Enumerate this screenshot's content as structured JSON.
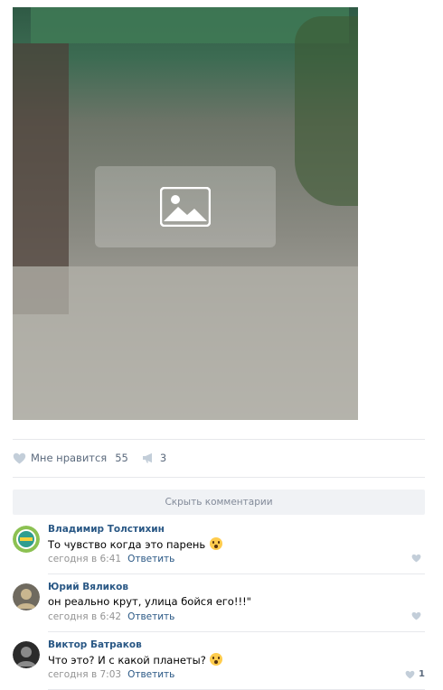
{
  "post": {
    "photo_alt": "Фото записи",
    "like_label": "Мне нравится",
    "like_count": "55",
    "share_count": "3"
  },
  "hide_comments_label": "Скрыть комментарии",
  "comments": [
    {
      "author": "Владимир Толстихин",
      "text": "То чувство когда это парень",
      "time": "сегодня в 6:41",
      "reply_label": "Ответить",
      "likes": ""
    },
    {
      "author": "Юрий Вяликов",
      "text": "он реально крут, улица бойся его!!!\"",
      "time": "сегодня в 6:42",
      "reply_label": "Ответить",
      "likes": ""
    },
    {
      "author": "Виктор Батраков",
      "text": "Что это? И с какой планеты?",
      "time": "сегодня в 7:03",
      "reply_label": "Ответить",
      "likes": "1"
    }
  ],
  "colors": {
    "link": "#2a5885",
    "muted": "#939393",
    "bar_bg": "#f0f2f5",
    "divider": "#e7e8ec",
    "icon": "#c3ced9"
  }
}
